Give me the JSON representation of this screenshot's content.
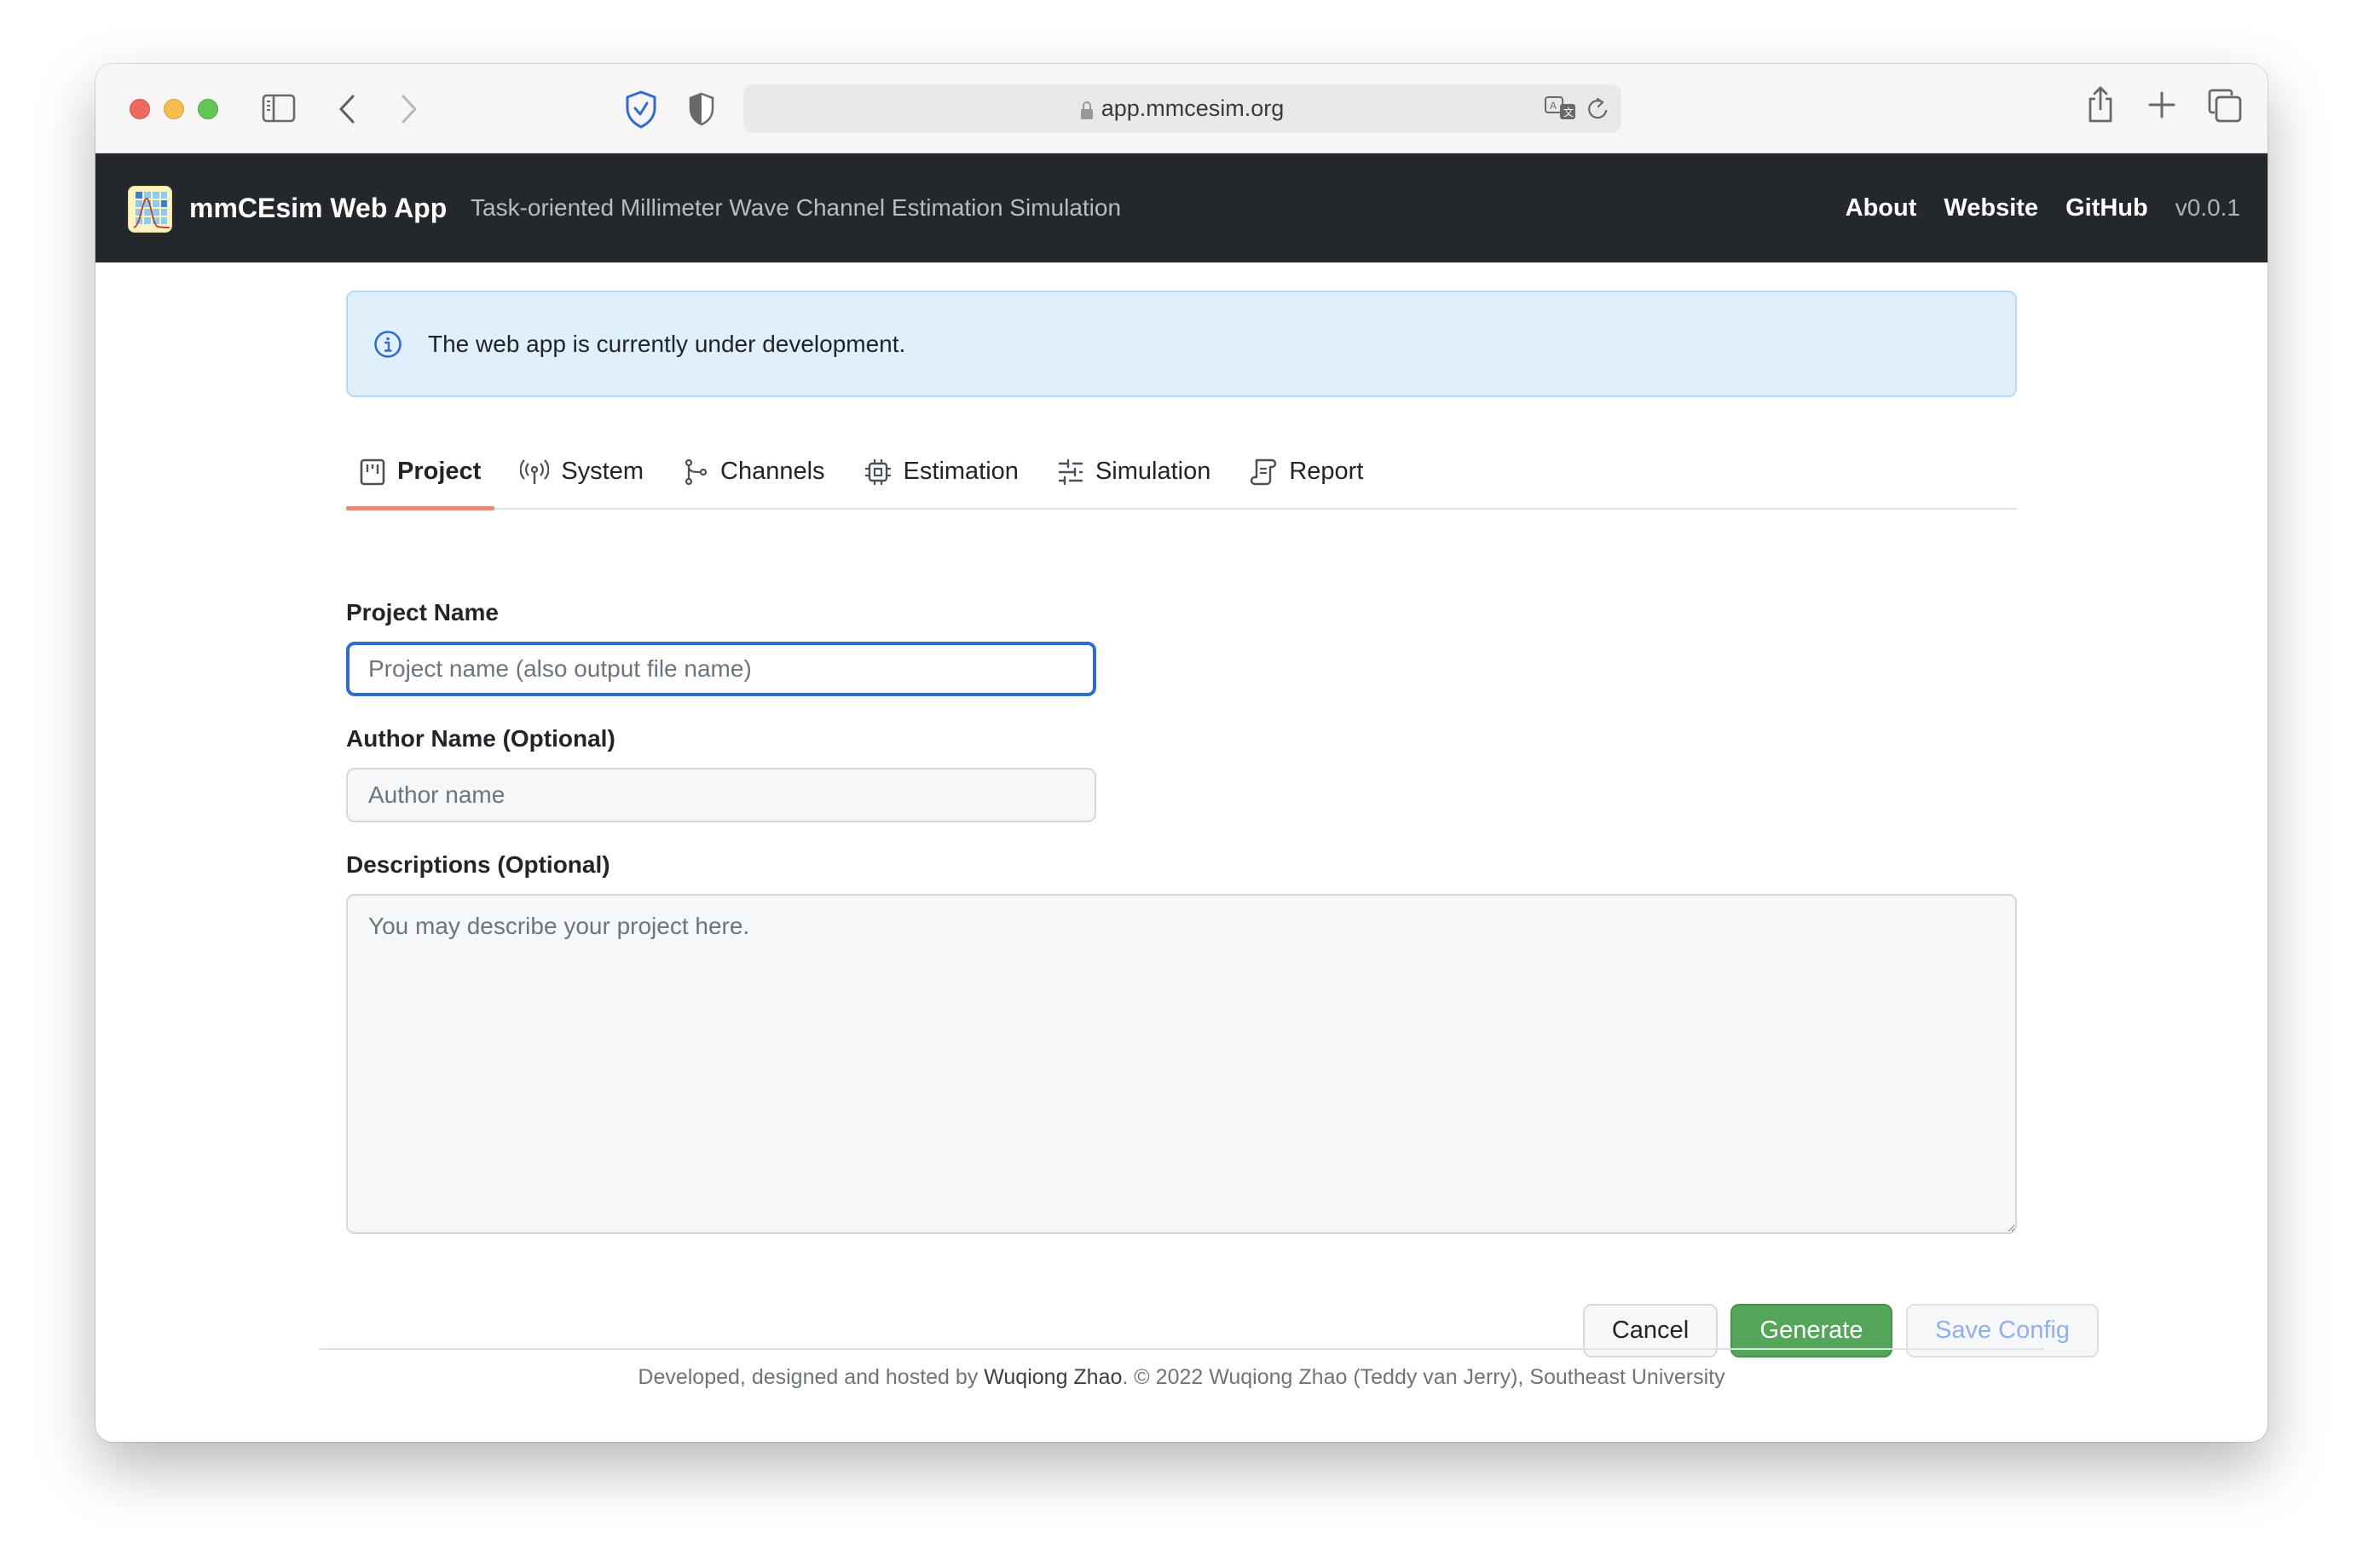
{
  "browser": {
    "url": "app.mmcesim.org",
    "icons": {
      "sidebar": "sidebar-icon",
      "back": "chevron-left-icon",
      "forward": "chevron-right-icon",
      "extension": "shield-check-icon",
      "privacy": "privacy-shield-icon",
      "lock": "lock-icon",
      "translate": "translate-icon",
      "reload": "reload-icon",
      "share": "share-icon",
      "new_tab": "plus-icon",
      "tab_overview": "tabs-icon"
    }
  },
  "navbar": {
    "brand_title": "mmCEsim Web App",
    "brand_subtitle": "Task-oriented Millimeter Wave Channel Estimation Simulation",
    "links": [
      {
        "label": "About"
      },
      {
        "label": "Website"
      },
      {
        "label": "GitHub"
      }
    ],
    "version": "v0.0.1"
  },
  "alert": {
    "icon": "info-circle-icon",
    "message": "The web app is currently under development."
  },
  "tabs": [
    {
      "label": "Project",
      "icon": "project-board-icon",
      "active": true
    },
    {
      "label": "System",
      "icon": "antenna-icon",
      "active": false
    },
    {
      "label": "Channels",
      "icon": "branch-icon",
      "active": false
    },
    {
      "label": "Estimation",
      "icon": "chip-icon",
      "active": false
    },
    {
      "label": "Simulation",
      "icon": "sliders-icon",
      "active": false
    },
    {
      "label": "Report",
      "icon": "report-scroll-icon",
      "active": false
    }
  ],
  "form": {
    "project_name": {
      "label": "Project Name",
      "value": "",
      "placeholder": "Project name (also output file name)"
    },
    "author_name": {
      "label": "Author Name (Optional)",
      "value": "",
      "placeholder": "Author name"
    },
    "descriptions": {
      "label": "Descriptions (Optional)",
      "value": "",
      "placeholder": "You may describe your project here."
    }
  },
  "actions": {
    "cancel": "Cancel",
    "generate": "Generate",
    "save_config": "Save Config"
  },
  "footer": {
    "prefix": "Developed, designed and hosted by ",
    "author_link": "Wuqiong Zhao",
    "suffix": ". © 2022 Wuqiong Zhao (Teddy van Jerry), Southeast University"
  },
  "colors": {
    "navbar_bg": "#24272c",
    "alert_bg": "#dff0fc",
    "active_tab_underline": "#ea8a72",
    "focus_border": "#2f6bd2",
    "generate_bg": "#55a55a",
    "save_config_text": "#8fb0ea"
  }
}
